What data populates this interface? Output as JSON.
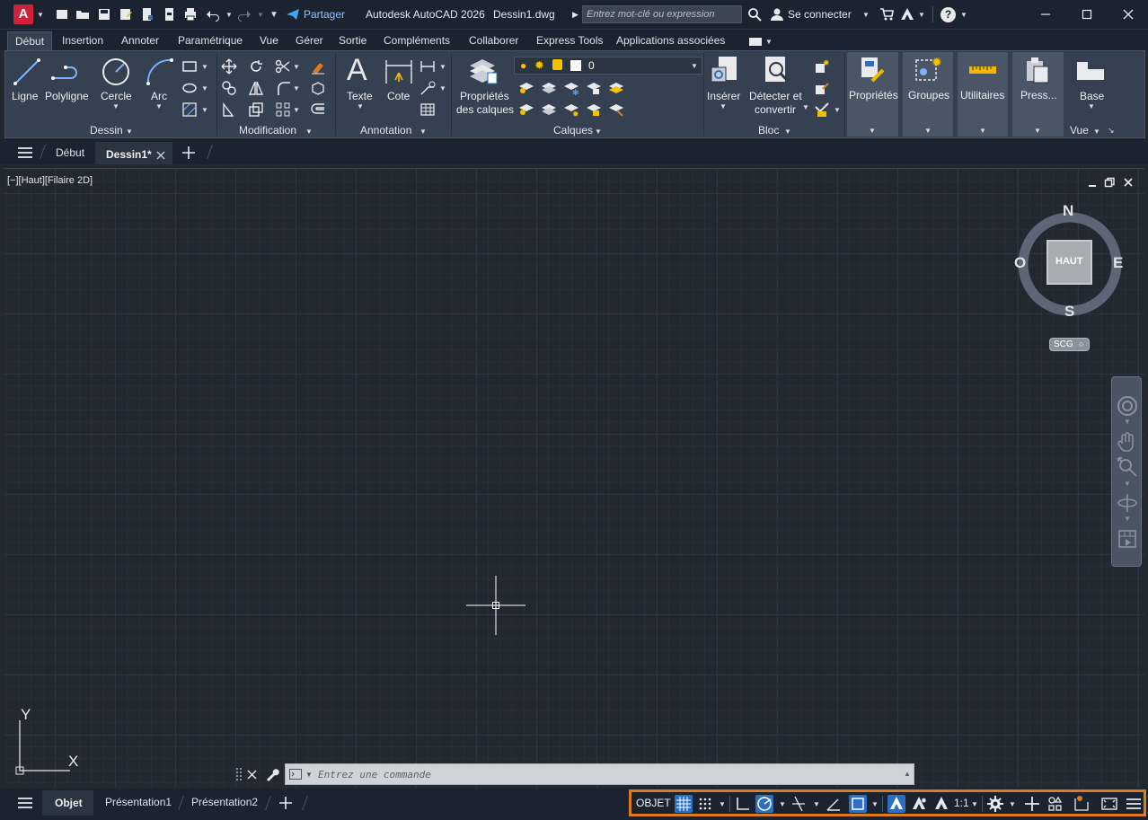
{
  "app": {
    "title": "Autodesk AutoCAD 2026",
    "document": "Dessin1.dwg",
    "logo_letter": "A",
    "share_label": "Partager",
    "search_placeholder": "Entrez mot-clé ou expression",
    "signin_label": "Se connecter",
    "help_glyph": "?"
  },
  "ribbon_tabs": [
    "Début",
    "Insertion",
    "Annoter",
    "Paramétrique",
    "Vue",
    "Gérer",
    "Sortie",
    "Compléments",
    "Collaborer",
    "Express Tools",
    "Applications associées"
  ],
  "panels": {
    "dessin": {
      "title": "Dessin",
      "tools": [
        "Ligne",
        "Polyligne",
        "Cercle",
        "Arc"
      ]
    },
    "modification": {
      "title": "Modification"
    },
    "annotation": {
      "title": "Annotation",
      "tools": [
        "Texte",
        "Cote"
      ]
    },
    "calques": {
      "title": "Calques",
      "props_line1": "Propriétés",
      "props_line2": "des calques",
      "layer_value": "0"
    },
    "bloc": {
      "title": "Bloc",
      "insert": "Insérer",
      "detect_line1": "Détecter et",
      "detect_line2": "convertir"
    },
    "proprietes": {
      "title": "Propriétés"
    },
    "groupes": {
      "title": "Groupes"
    },
    "utilitaires": {
      "title": "Utilitaires"
    },
    "presse": {
      "title": "Press..."
    },
    "vue": {
      "base": "Base",
      "title": "Vue"
    }
  },
  "doc_tabs": {
    "start": "Début",
    "current": "Dessin1*"
  },
  "viewport": {
    "label": "[−][Haut][Filaire 2D]",
    "viewcube": {
      "north": "N",
      "south": "S",
      "east": "E",
      "west": "O",
      "face": "HAUT",
      "ucs": "SCG"
    },
    "ucs_axes": {
      "x": "X",
      "y": "Y"
    }
  },
  "command": {
    "placeholder": "Entrez une commande"
  },
  "layout_tabs": [
    "Objet",
    "Présentation1",
    "Présentation2"
  ],
  "status": {
    "mode": "OBJET",
    "scale": "1:1"
  },
  "colors": {
    "accent": "#2a6fc2",
    "highlight_border": "#e07b1a",
    "logo": "#d1213a"
  }
}
